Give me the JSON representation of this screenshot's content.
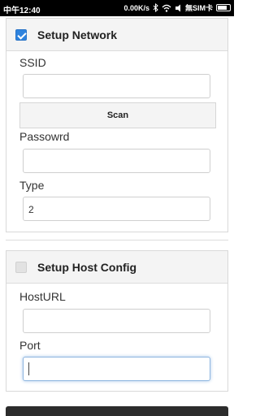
{
  "statusbar": {
    "time": "中午12:40",
    "speed": "0.00K/s",
    "carrier": "無SIM卡",
    "battery_level": 0.8,
    "icons": [
      "bluetooth-icon",
      "wifi-icon",
      "mute-icon",
      "battery-icon"
    ]
  },
  "network_section": {
    "title": "Setup Network",
    "checked": true,
    "ssid_label": "SSID",
    "ssid_value": "",
    "scan_label": "Scan",
    "password_label": "Passowrd",
    "password_value": "",
    "type_label": "Type",
    "type_value": "2"
  },
  "host_section": {
    "title": "Setup Host Config",
    "checked": false,
    "hosturl_label": "HostURL",
    "hosturl_value": "",
    "port_label": "Port",
    "port_value": ""
  },
  "colors": {
    "accent": "#2e83de",
    "statusbar": "#000000",
    "header_bg": "#f4f4f4"
  }
}
